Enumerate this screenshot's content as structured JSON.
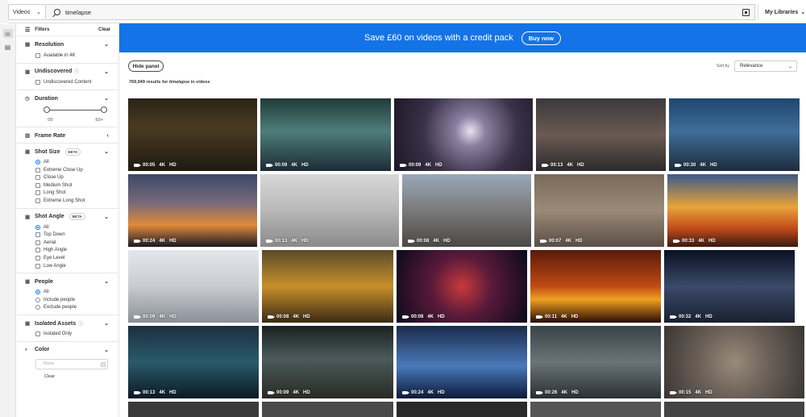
{
  "topbar": {
    "content_type": "Videos",
    "search_value": "timelapse",
    "libraries_label": "My Libraries"
  },
  "filters": {
    "title": "Filters",
    "clear_label": "Clear",
    "resolution": {
      "title": "Resolution",
      "option": "Available in 4K"
    },
    "undiscovered": {
      "title": "Undiscovered",
      "option": "Undiscovered Content"
    },
    "duration": {
      "title": "Duration",
      "min_label": ":00",
      "max_label": ":60+"
    },
    "frame_rate": {
      "title": "Frame Rate"
    },
    "shot_size": {
      "title": "Shot Size",
      "badge": "BETA",
      "options": [
        "All",
        "Extreme Close Up",
        "Close Up",
        "Medium Shot",
        "Long Shot",
        "Extreme Long Shot"
      ]
    },
    "shot_angle": {
      "title": "Shot Angle",
      "badge": "BETA",
      "options": [
        "All",
        "Top Down",
        "Aerial",
        "High Angle",
        "Eye Level",
        "Low Angle"
      ]
    },
    "people": {
      "title": "People",
      "options": [
        "All",
        "Include people",
        "Exclude people"
      ]
    },
    "isolated": {
      "title": "Isolated Assets",
      "option": "Isolated Only"
    },
    "color": {
      "title": "Color",
      "placeholder": "None",
      "clear_label": "Clear"
    }
  },
  "banner": {
    "message": "Save £60 on videos with a credit pack",
    "button_label": "Buy now"
  },
  "toolbar": {
    "hide_panel_label": "Hide panel",
    "results_count": "769,949",
    "results_mid": " results for ",
    "results_query": "timelapse",
    "results_tail": " in videos",
    "sort_label": "Sort by",
    "sort_value": "Relevance"
  },
  "colors": {
    "accent": "#1473e6"
  },
  "videos": [
    {
      "duration": "00:05",
      "res": "4K",
      "quality": "HD"
    },
    {
      "duration": "00:09",
      "res": "4K",
      "quality": "HD"
    },
    {
      "duration": "00:09",
      "res": "4K",
      "quality": "HD"
    },
    {
      "duration": "00:13",
      "res": "4K",
      "quality": "HD"
    },
    {
      "duration": "00:30",
      "res": "4K",
      "quality": "HD"
    },
    {
      "duration": "00:24",
      "res": "4K",
      "quality": "HD"
    },
    {
      "duration": "00:13",
      "res": "4K",
      "quality": "HD"
    },
    {
      "duration": "00:08",
      "res": "4K",
      "quality": "HD"
    },
    {
      "duration": "00:07",
      "res": "4K",
      "quality": "HD"
    },
    {
      "duration": "00:33",
      "res": "4K",
      "quality": "HD"
    },
    {
      "duration": "00:09",
      "res": "4K",
      "quality": "HD"
    },
    {
      "duration": "00:08",
      "res": "4K",
      "quality": "HD"
    },
    {
      "duration": "00:08",
      "res": "4K",
      "quality": "HD"
    },
    {
      "duration": "00:11",
      "res": "4K",
      "quality": "HD"
    },
    {
      "duration": "00:32",
      "res": "4K",
      "quality": "HD"
    },
    {
      "duration": "00:13",
      "res": "4K",
      "quality": "HD"
    },
    {
      "duration": "00:09",
      "res": "4K",
      "quality": "HD"
    },
    {
      "duration": "00:24",
      "res": "4K",
      "quality": "HD"
    },
    {
      "duration": "00:26",
      "res": "4K",
      "quality": "HD"
    },
    {
      "duration": "00:15",
      "res": "4K",
      "quality": "HD"
    }
  ]
}
